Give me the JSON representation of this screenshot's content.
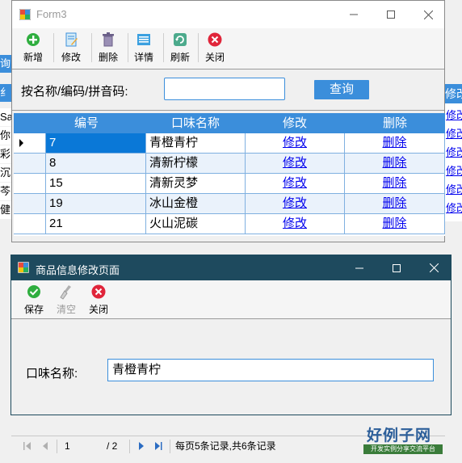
{
  "background_window": {
    "left_fragments": [
      "询",
      "纟",
      "Sa",
      "你",
      "彩",
      "沉",
      "芩",
      "健"
    ],
    "right_header": "修改",
    "right_links": [
      "修改",
      "修改",
      "修改",
      "修改",
      "修改",
      "修改"
    ]
  },
  "form3": {
    "title": "Form3",
    "toolbar": [
      {
        "label": "新增",
        "icon": "add-icon"
      },
      {
        "label": "修改",
        "icon": "edit-icon"
      },
      {
        "label": "删除",
        "icon": "trash-icon"
      },
      {
        "label": "详情",
        "icon": "details-icon"
      },
      {
        "label": "刷新",
        "icon": "refresh-icon"
      },
      {
        "label": "关闭",
        "icon": "close-circle-icon"
      }
    ],
    "search": {
      "label": "按名称/编码/拼音码:",
      "value": "",
      "button": "查询"
    },
    "grid": {
      "columns": [
        "编号",
        "口味名称",
        "修改",
        "删除"
      ],
      "rows": [
        {
          "id": "7",
          "name": "青橙青柠",
          "edit": "修改",
          "del": "删除"
        },
        {
          "id": "8",
          "name": "清新柠檬",
          "edit": "修改",
          "del": "删除"
        },
        {
          "id": "15",
          "name": "清新灵梦",
          "edit": "修改",
          "del": "删除"
        },
        {
          "id": "19",
          "name": "冰山金橙",
          "edit": "修改",
          "del": "删除"
        },
        {
          "id": "21",
          "name": "火山泥碳",
          "edit": "修改",
          "del": "删除"
        }
      ]
    }
  },
  "edit_dialog": {
    "title": "商品信息修改页面",
    "toolbar": [
      {
        "label": "保存",
        "icon": "save-check-icon"
      },
      {
        "label": "清空",
        "icon": "broom-icon"
      },
      {
        "label": "关闭",
        "icon": "close-circle-icon"
      }
    ],
    "field_label": "口味名称:",
    "field_value": "青橙青柠"
  },
  "pager": {
    "current_page": "1",
    "total_pages": "/ 2",
    "summary": "每页5条记录,共6条记录"
  },
  "logo": {
    "main": "好例子网",
    "sub": "开发实例分享交流平台"
  },
  "colors": {
    "accent": "#3b8edb",
    "dialog_title": "#1e4a5e",
    "link": "#0000ee",
    "selection": "#0a78d7"
  }
}
